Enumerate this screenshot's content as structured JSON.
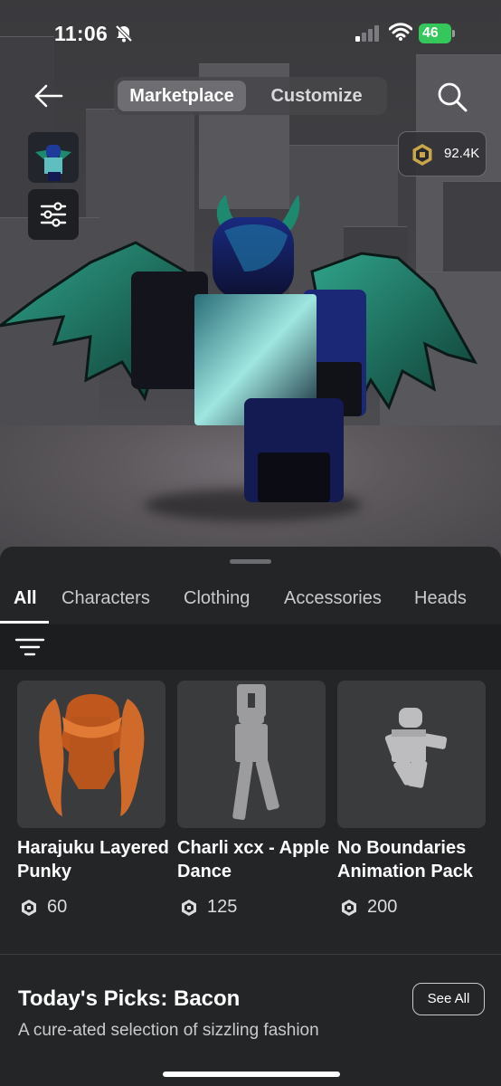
{
  "status_bar": {
    "time": "11:06",
    "battery": "46"
  },
  "nav": {
    "tabs": [
      "Marketplace",
      "Customize"
    ],
    "active_tab": "Marketplace",
    "robux_balance": "92.4K"
  },
  "catalog": {
    "categories": [
      "All",
      "Characters",
      "Clothing",
      "Accessories",
      "Heads"
    ],
    "active_category": "All",
    "items": [
      {
        "name": "Harajuku Layered Punky",
        "price": "60"
      },
      {
        "name": "Charli xcx - Apple Dance",
        "price": "125"
      },
      {
        "name": "No Boundaries Animation Pack",
        "price": "200"
      }
    ]
  },
  "picks": {
    "title": "Today's Picks: Bacon",
    "subtitle": "A cure-ated selection of sizzling fashion",
    "see_all_label": "See All"
  },
  "colors": {
    "background": "#232527",
    "card": "#393b3d",
    "battery_green": "#34c759",
    "wing_teal": "#1c6b5a",
    "avatar_blue": "#1e2f8a"
  },
  "icons": [
    "bell-slash-icon",
    "signal-icon",
    "wifi-icon",
    "back-arrow-icon",
    "search-icon",
    "sliders-icon",
    "robux-icon",
    "filter-icon"
  ]
}
